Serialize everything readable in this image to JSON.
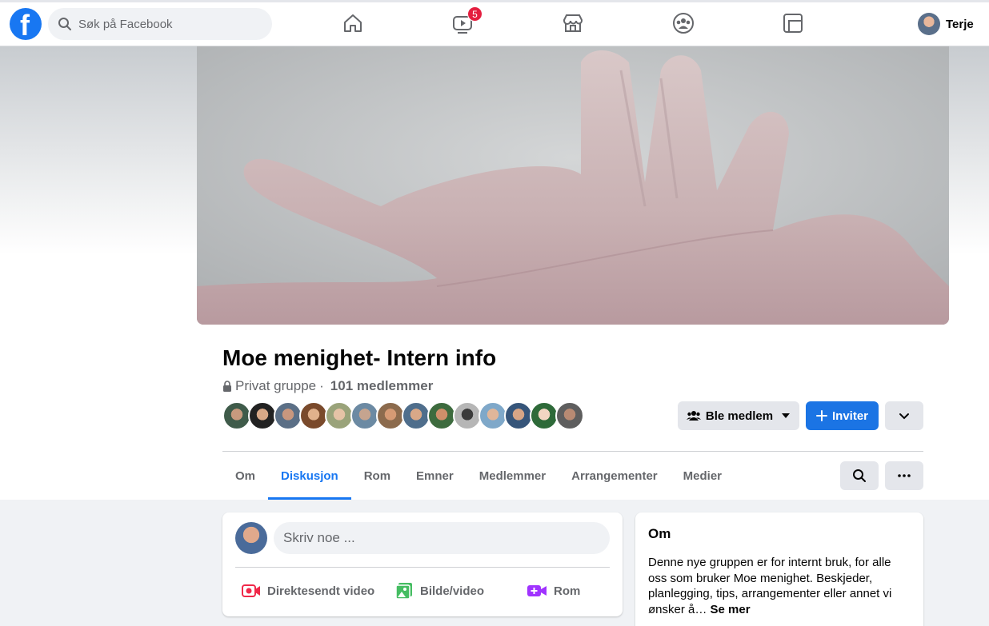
{
  "topbar": {
    "search_placeholder": "Søk på Facebook",
    "video_badge": "5",
    "user_name": "Terje",
    "nav_icons": [
      "home-icon",
      "watch-icon",
      "marketplace-icon",
      "groups-icon",
      "gaming-icon"
    ]
  },
  "group": {
    "title": "Moe menighet- Intern info",
    "privacy": "Privat gruppe",
    "separator": "·",
    "member_count": "101 medlemmer"
  },
  "actions": {
    "join_label": "Ble medlem",
    "invite_label": "Inviter"
  },
  "tabs": [
    {
      "label": "Om",
      "active": false
    },
    {
      "label": "Diskusjon",
      "active": true
    },
    {
      "label": "Rom",
      "active": false
    },
    {
      "label": "Emner",
      "active": false
    },
    {
      "label": "Medlemmer",
      "active": false
    },
    {
      "label": "Arrangementer",
      "active": false
    },
    {
      "label": "Medier",
      "active": false
    }
  ],
  "composer": {
    "placeholder": "Skriv noe ...",
    "actions": [
      "Direktesendt video",
      "Bilde/video",
      "Rom"
    ]
  },
  "about": {
    "heading": "Om",
    "text": "Denne nye gruppen er for internt bruk, for alle oss som bruker Moe menighet. Beskjeder, planlegging, tips, arrangementer eller annet vi ønsker å…",
    "more": "Se mer"
  },
  "colors": {
    "accent": "#1877f2",
    "badge": "#e41e3f",
    "live": "#f02849",
    "photo": "#45bd62",
    "room": "#a033ff"
  }
}
